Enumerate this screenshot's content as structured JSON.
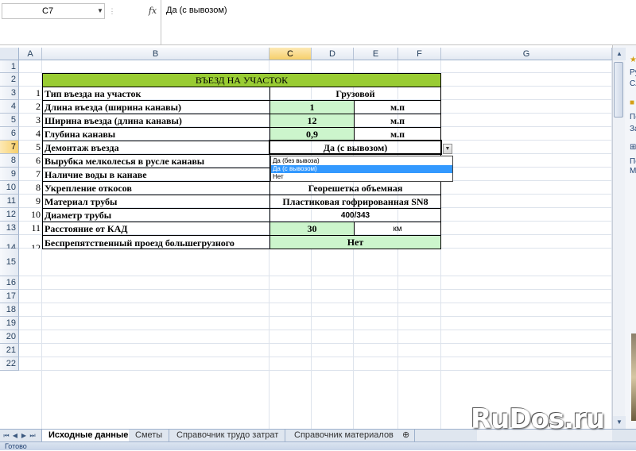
{
  "formula_bar": {
    "name_box": "C7",
    "fx": "fx",
    "formula": "Да (с вывозом)"
  },
  "columns": [
    "A",
    "B",
    "C",
    "D",
    "E",
    "F",
    "G"
  ],
  "rows": [
    "1",
    "2",
    "3",
    "4",
    "5",
    "6",
    "7",
    "8",
    "9",
    "10",
    "11",
    "12",
    "13",
    "14",
    "15",
    "16",
    "17",
    "18",
    "19",
    "20",
    "21",
    "22"
  ],
  "selected": {
    "column": "C",
    "row": "7"
  },
  "table": {
    "title": "ВЪЕЗД НА УЧАСТОК",
    "items": [
      {
        "n": "1",
        "label": "Тип въезда на участок",
        "value": "Грузовой",
        "unit": ""
      },
      {
        "n": "2",
        "label": "Длина въезда (ширина канавы)",
        "value": "1",
        "unit": "м.п"
      },
      {
        "n": "3",
        "label": "Ширина въезда (длина канавы)",
        "value": "12",
        "unit": "м.п"
      },
      {
        "n": "4",
        "label": "Глубина канавы",
        "value": "0,9",
        "unit": "м.п"
      },
      {
        "n": "5",
        "label": "Демонтаж въезда",
        "value": "Да (с вывозом)",
        "unit": ""
      },
      {
        "n": "6",
        "label": "Вырубка мелколесья в русле канавы",
        "value": "",
        "unit": ""
      },
      {
        "n": "7",
        "label": "Наличие воды в канаве",
        "value": "",
        "unit": ""
      },
      {
        "n": "8",
        "label": "Укрепление откосов",
        "value": "Георешетка объемная",
        "unit": ""
      },
      {
        "n": "9",
        "label": "Материал трубы",
        "value": "Пластиковая гофрированная SN8",
        "unit": ""
      },
      {
        "n": "10",
        "label": "Диаметр трубы",
        "value": "400/343",
        "unit": ""
      },
      {
        "n": "11",
        "label": "Расстояние от КАД",
        "value": "30",
        "unit": "км"
      },
      {
        "n": "12",
        "label": "Беспрепятственный проезд большегрузного транспорта",
        "value": "Нет",
        "unit": ""
      }
    ]
  },
  "dropdown": {
    "options": [
      "Да (без вывоза)",
      "Да (с вывозом)",
      "Нет"
    ],
    "highlighted_index": 1
  },
  "right_panel": {
    "texts": [
      "Ру",
      "Сл",
      "Пе",
      "За",
      "Пе",
      "М"
    ]
  },
  "sheet_tabs": [
    "Исходные данные",
    "Сметы",
    "Справочник трудо затрат",
    "Справочник материалов"
  ],
  "active_tab": "Исходные данные",
  "status": "Готово",
  "watermark": "RuDos.ru",
  "colors": {
    "title_fill": "#99cc33",
    "input_fill": "#ccf5cc",
    "highlight": "#3399ff"
  }
}
